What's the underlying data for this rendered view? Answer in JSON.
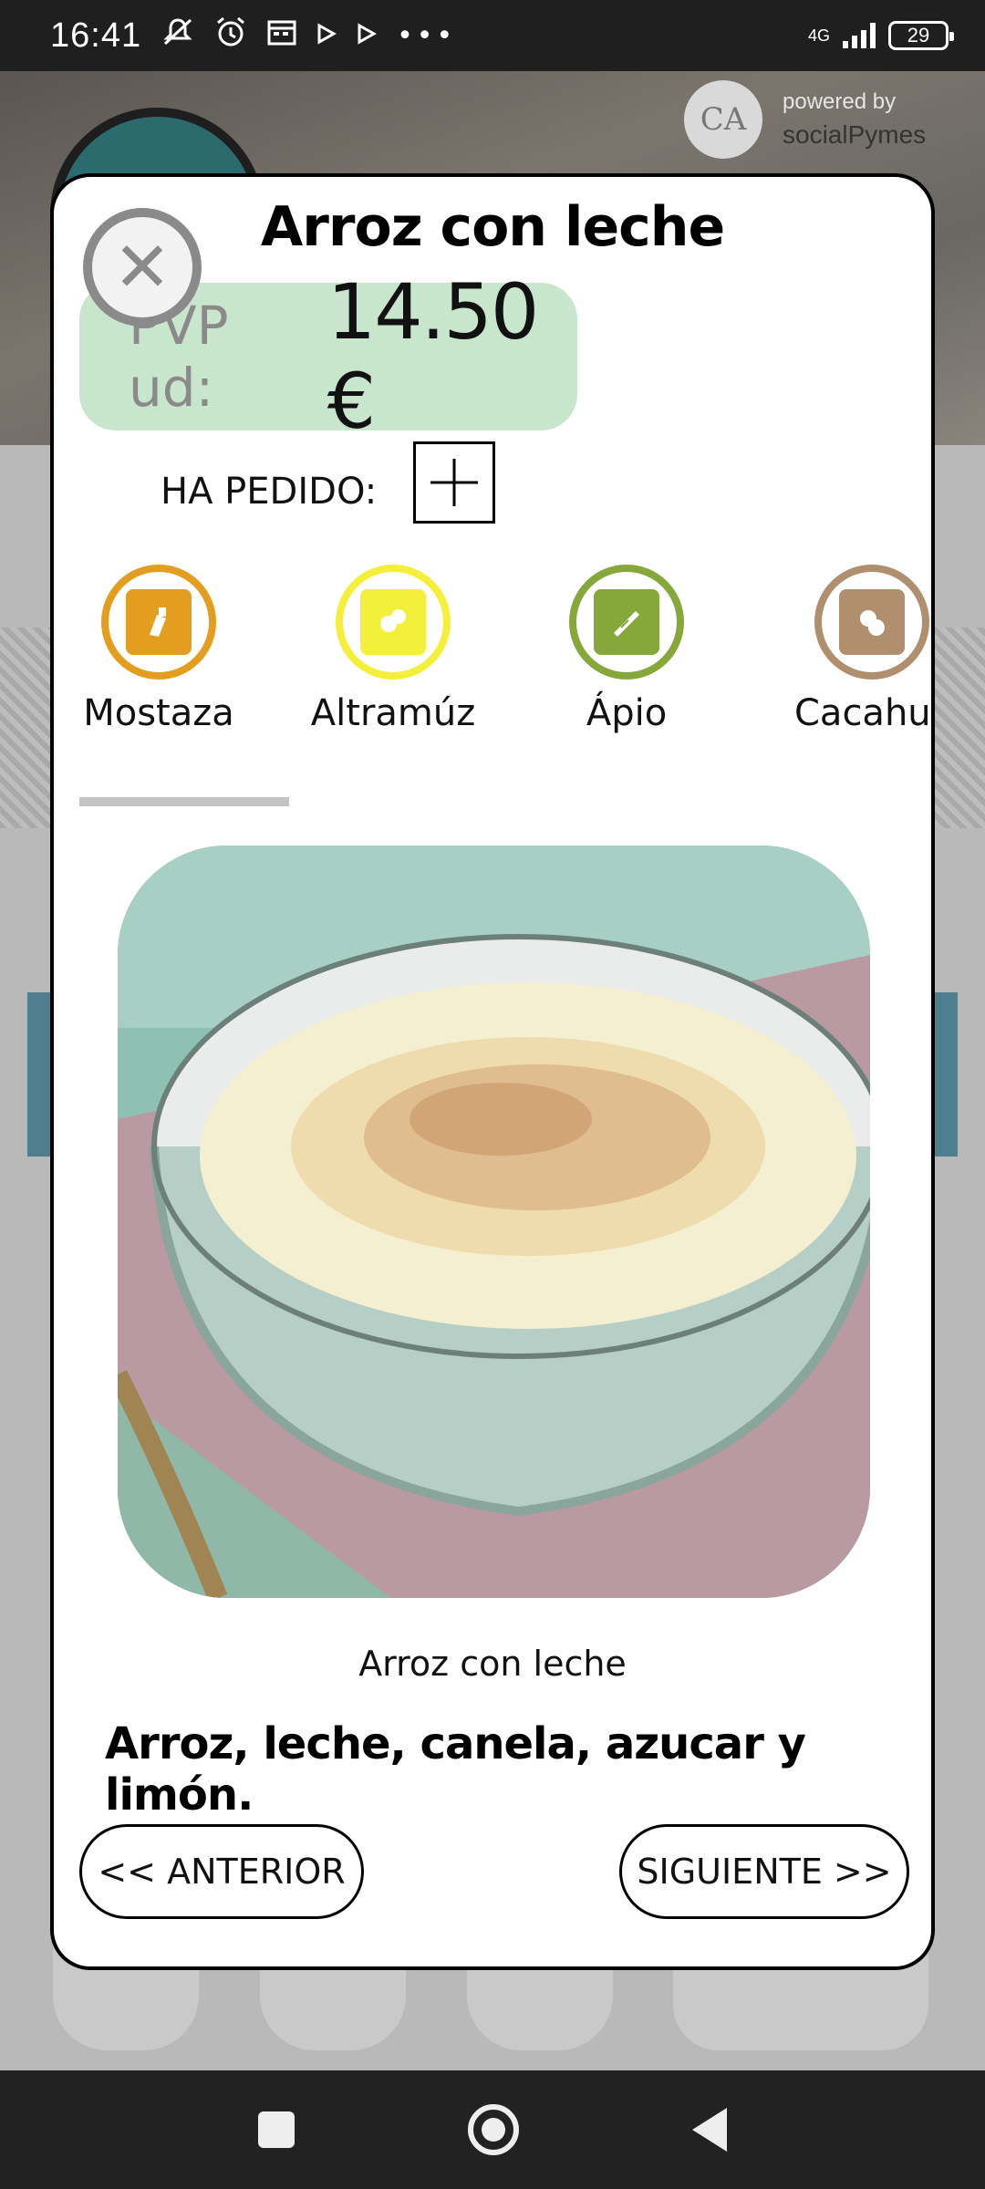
{
  "status_bar": {
    "time": "16:41",
    "network": "4G",
    "battery": "29",
    "icons": [
      "mute-icon",
      "alarm-icon",
      "calendar-icon",
      "play-icon",
      "play-icon",
      "more-icon"
    ]
  },
  "background": {
    "powered_by_label": "powered by",
    "powered_by_brand": "socialPymes",
    "logo_initials": "CA"
  },
  "modal": {
    "title": "Arroz con leche",
    "close_icon": "close-icon",
    "price": {
      "label": "PVP ud:",
      "value": "14.50 €"
    },
    "ordered_label": "HA PEDIDO:",
    "add_icon": "plus-icon",
    "allergens": [
      {
        "name": "Mostaza",
        "icon": "mustard-icon",
        "color": "#e39d1f"
      },
      {
        "name": "Altramúz",
        "icon": "lupin-icon",
        "color": "#f4ef3a"
      },
      {
        "name": "Ápio",
        "icon": "celery-icon",
        "color": "#86a83b"
      },
      {
        "name": "Cacahu",
        "icon": "peanut-icon",
        "color": "#b08f6e"
      }
    ],
    "dish_caption": "Arroz con leche",
    "dish_description": "Arroz, leche, canela, azucar y limón.",
    "prev_label": "<< ANTERIOR",
    "next_label": "SIGUIENTE >>"
  },
  "android_nav": {
    "recents": "recents-icon",
    "home": "home-icon",
    "back": "back-icon"
  }
}
